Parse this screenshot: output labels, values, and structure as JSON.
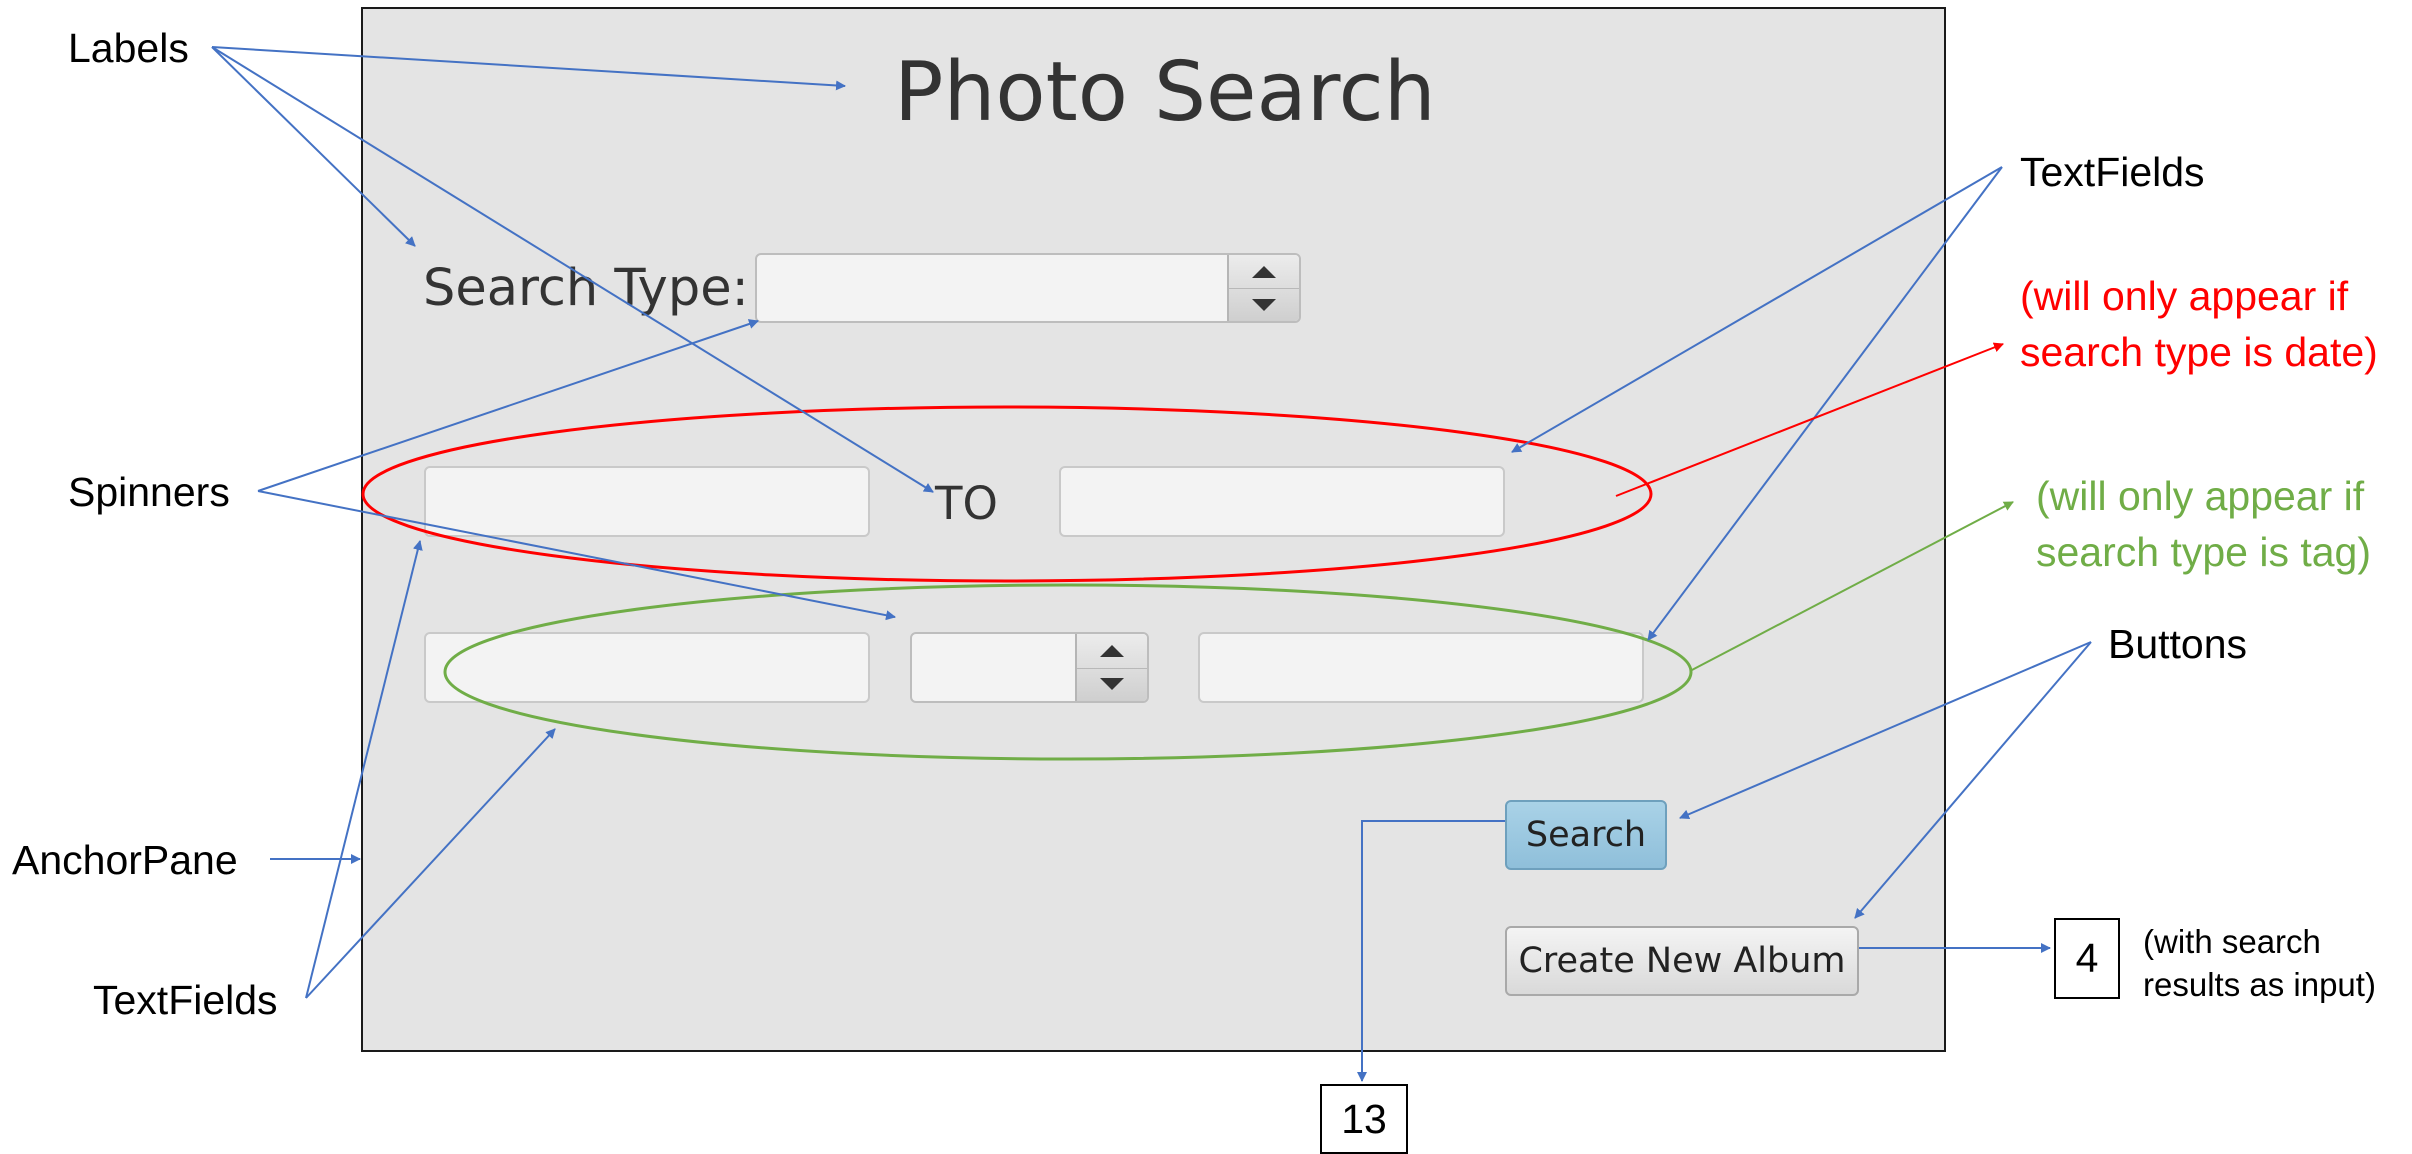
{
  "window": {
    "title": "Photo Search",
    "search_type_label": "Search Type:",
    "to_label": "TO",
    "search_button": "Search",
    "create_album_button": "Create New Album"
  },
  "annotations": {
    "labels": "Labels",
    "spinners": "Spinners",
    "anchor_pane": "AnchorPane",
    "textfields_left": "TextFields",
    "textfields_right": "TextFields",
    "buttons": "Buttons",
    "date_note_line1": "(will only appear if",
    "date_note_line2": "search type is date)",
    "tag_note_line1": "(will only appear if",
    "tag_note_line2": "search type is tag)",
    "input_note_line1": "(with search",
    "input_note_line2": "results as input)",
    "box_search_target": "13",
    "box_create_target": "4"
  },
  "colors": {
    "arrow": "#4472c4",
    "date_group": "#ff0000",
    "tag_group": "#70ad47",
    "pane_background": "#e4e4e4",
    "search_button": "#9cc8e0"
  }
}
